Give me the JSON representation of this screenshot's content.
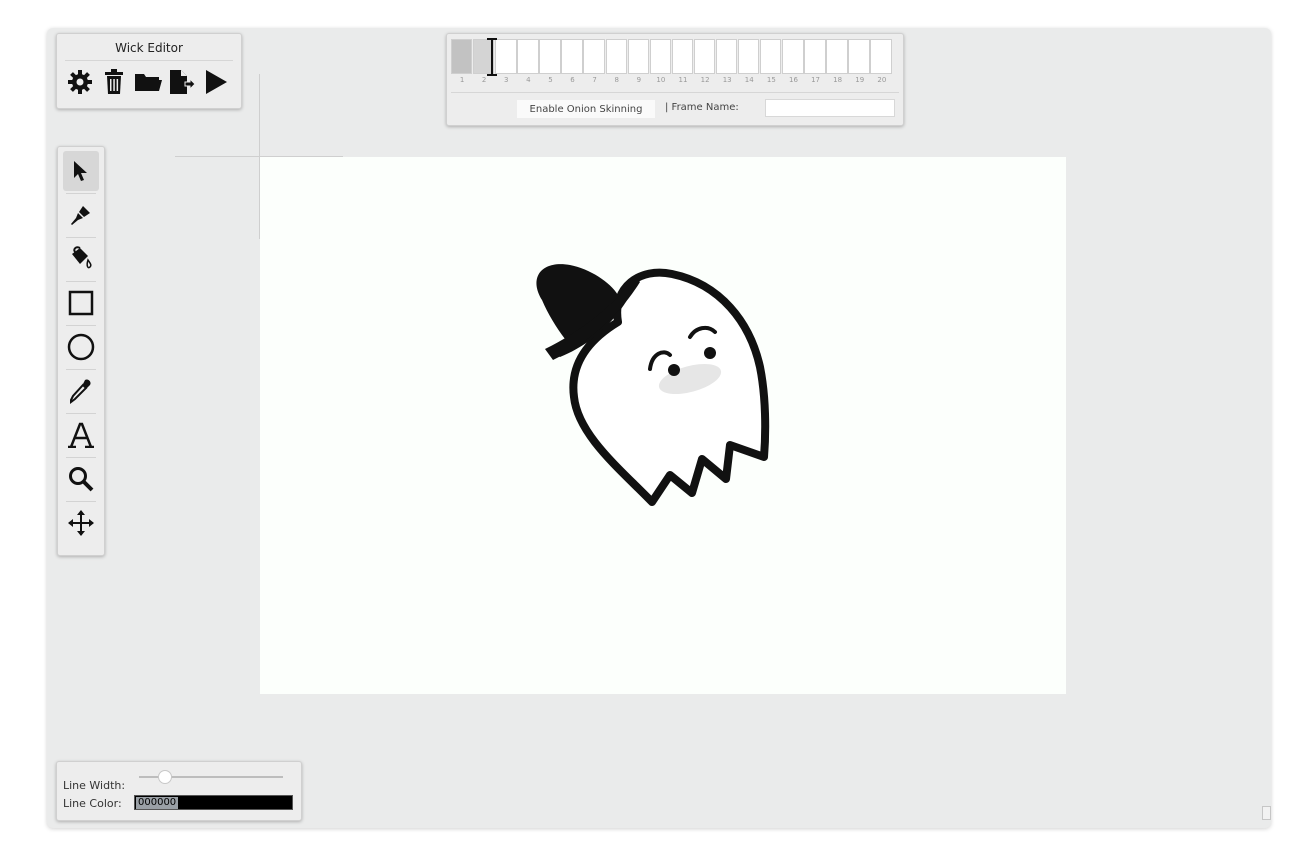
{
  "header": {
    "title": "Wick Editor",
    "icons": [
      "gear-icon",
      "trash-icon",
      "folder-icon",
      "export-icon",
      "play-icon"
    ]
  },
  "timeline": {
    "frame_numbers": [
      "1",
      "2",
      "3",
      "4",
      "5",
      "6",
      "7",
      "8",
      "9",
      "10",
      "11",
      "12",
      "13",
      "14",
      "15",
      "16",
      "17",
      "18",
      "19",
      "20"
    ],
    "filled_frames": [
      1
    ],
    "current_frame": 2,
    "onion_skinning_label": "Enable Onion Skinning",
    "frame_name_label": "| Frame Name:",
    "frame_name_value": ""
  },
  "tools": {
    "items": [
      "cursor-icon",
      "brush-icon",
      "fill-bucket-icon",
      "rectangle-icon",
      "ellipse-icon",
      "dropper-icon",
      "text-icon",
      "zoom-icon",
      "pan-icon"
    ],
    "active": "cursor-icon"
  },
  "properties": {
    "line_width_label": "Line Width:",
    "line_width_value": 0.15,
    "line_color_label": "Line Color:",
    "line_color_value": "000000"
  },
  "colors": {
    "panel_bg": "#ededed",
    "editor_bg": "#eaebeb",
    "canvas_bg": "#fcfffc",
    "line_color": "#000000"
  }
}
